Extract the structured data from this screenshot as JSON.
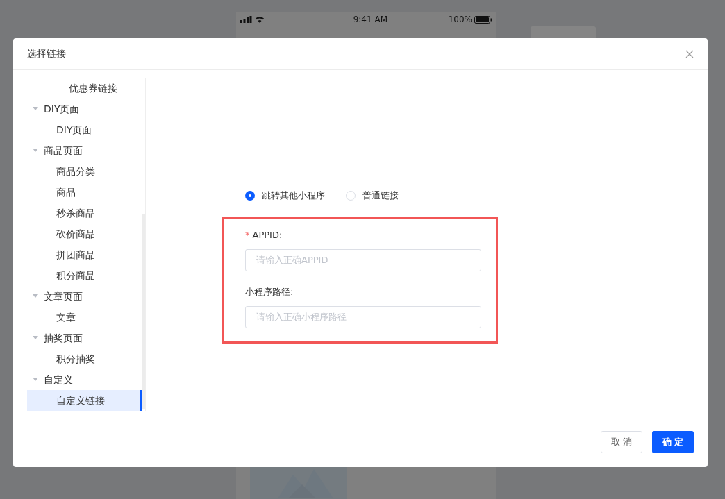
{
  "background": {
    "status_bar": {
      "time": "9:41 AM",
      "battery": "100%"
    }
  },
  "dialog": {
    "title": "选择链接",
    "scrolled_items": [
      {
        "label": "优惠券链接",
        "selected": false
      }
    ],
    "tree": [
      {
        "label": "DIY页面",
        "expanded": true,
        "children": [
          {
            "label": "DIY页面",
            "selected": false
          }
        ]
      },
      {
        "label": "商品页面",
        "expanded": true,
        "children": [
          {
            "label": "商品分类",
            "selected": false
          },
          {
            "label": "商品",
            "selected": false
          },
          {
            "label": "秒杀商品",
            "selected": false
          },
          {
            "label": "砍价商品",
            "selected": false
          },
          {
            "label": "拼团商品",
            "selected": false
          },
          {
            "label": "积分商品",
            "selected": false
          }
        ]
      },
      {
        "label": "文章页面",
        "expanded": true,
        "children": [
          {
            "label": "文章",
            "selected": false
          }
        ]
      },
      {
        "label": "抽奖页面",
        "expanded": true,
        "children": [
          {
            "label": "积分抽奖",
            "selected": false
          }
        ]
      },
      {
        "label": "自定义",
        "expanded": true,
        "children": [
          {
            "label": "自定义链接",
            "selected": true
          }
        ]
      }
    ],
    "radios": [
      {
        "label": "跳转其他小程序",
        "selected": true
      },
      {
        "label": "普通链接",
        "selected": false
      }
    ],
    "fields": [
      {
        "label": "APPID:",
        "required": true,
        "required_mark": "*",
        "placeholder": "请输入正确APPID"
      },
      {
        "label": "小程序路径:",
        "required": false,
        "placeholder": "请输入正确小程序路径"
      }
    ],
    "buttons": [
      {
        "label": "取 消",
        "kind": "secondary"
      },
      {
        "label": "确 定",
        "kind": "primary"
      }
    ]
  }
}
